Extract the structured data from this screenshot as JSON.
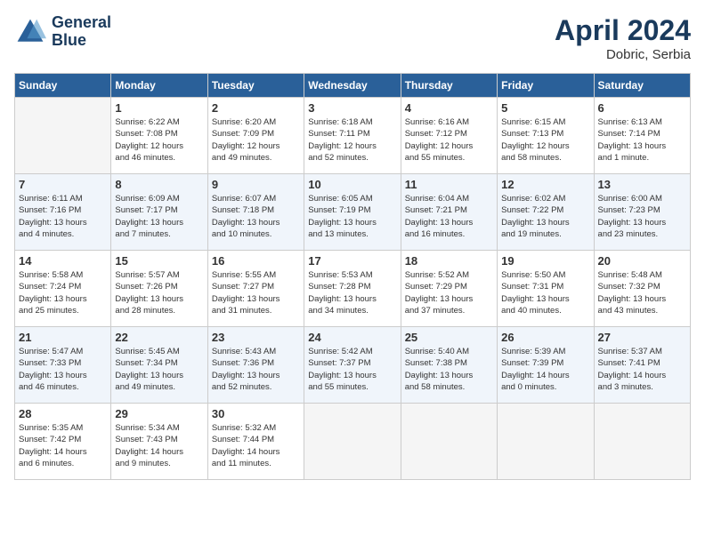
{
  "header": {
    "logo_line1": "General",
    "logo_line2": "Blue",
    "month_title": "April 2024",
    "location": "Dobric, Serbia"
  },
  "weekdays": [
    "Sunday",
    "Monday",
    "Tuesday",
    "Wednesday",
    "Thursday",
    "Friday",
    "Saturday"
  ],
  "weeks": [
    [
      {
        "day": "",
        "info": ""
      },
      {
        "day": "1",
        "info": "Sunrise: 6:22 AM\nSunset: 7:08 PM\nDaylight: 12 hours\nand 46 minutes."
      },
      {
        "day": "2",
        "info": "Sunrise: 6:20 AM\nSunset: 7:09 PM\nDaylight: 12 hours\nand 49 minutes."
      },
      {
        "day": "3",
        "info": "Sunrise: 6:18 AM\nSunset: 7:11 PM\nDaylight: 12 hours\nand 52 minutes."
      },
      {
        "day": "4",
        "info": "Sunrise: 6:16 AM\nSunset: 7:12 PM\nDaylight: 12 hours\nand 55 minutes."
      },
      {
        "day": "5",
        "info": "Sunrise: 6:15 AM\nSunset: 7:13 PM\nDaylight: 12 hours\nand 58 minutes."
      },
      {
        "day": "6",
        "info": "Sunrise: 6:13 AM\nSunset: 7:14 PM\nDaylight: 13 hours\nand 1 minute."
      }
    ],
    [
      {
        "day": "7",
        "info": "Sunrise: 6:11 AM\nSunset: 7:16 PM\nDaylight: 13 hours\nand 4 minutes."
      },
      {
        "day": "8",
        "info": "Sunrise: 6:09 AM\nSunset: 7:17 PM\nDaylight: 13 hours\nand 7 minutes."
      },
      {
        "day": "9",
        "info": "Sunrise: 6:07 AM\nSunset: 7:18 PM\nDaylight: 13 hours\nand 10 minutes."
      },
      {
        "day": "10",
        "info": "Sunrise: 6:05 AM\nSunset: 7:19 PM\nDaylight: 13 hours\nand 13 minutes."
      },
      {
        "day": "11",
        "info": "Sunrise: 6:04 AM\nSunset: 7:21 PM\nDaylight: 13 hours\nand 16 minutes."
      },
      {
        "day": "12",
        "info": "Sunrise: 6:02 AM\nSunset: 7:22 PM\nDaylight: 13 hours\nand 19 minutes."
      },
      {
        "day": "13",
        "info": "Sunrise: 6:00 AM\nSunset: 7:23 PM\nDaylight: 13 hours\nand 23 minutes."
      }
    ],
    [
      {
        "day": "14",
        "info": "Sunrise: 5:58 AM\nSunset: 7:24 PM\nDaylight: 13 hours\nand 25 minutes."
      },
      {
        "day": "15",
        "info": "Sunrise: 5:57 AM\nSunset: 7:26 PM\nDaylight: 13 hours\nand 28 minutes."
      },
      {
        "day": "16",
        "info": "Sunrise: 5:55 AM\nSunset: 7:27 PM\nDaylight: 13 hours\nand 31 minutes."
      },
      {
        "day": "17",
        "info": "Sunrise: 5:53 AM\nSunset: 7:28 PM\nDaylight: 13 hours\nand 34 minutes."
      },
      {
        "day": "18",
        "info": "Sunrise: 5:52 AM\nSunset: 7:29 PM\nDaylight: 13 hours\nand 37 minutes."
      },
      {
        "day": "19",
        "info": "Sunrise: 5:50 AM\nSunset: 7:31 PM\nDaylight: 13 hours\nand 40 minutes."
      },
      {
        "day": "20",
        "info": "Sunrise: 5:48 AM\nSunset: 7:32 PM\nDaylight: 13 hours\nand 43 minutes."
      }
    ],
    [
      {
        "day": "21",
        "info": "Sunrise: 5:47 AM\nSunset: 7:33 PM\nDaylight: 13 hours\nand 46 minutes."
      },
      {
        "day": "22",
        "info": "Sunrise: 5:45 AM\nSunset: 7:34 PM\nDaylight: 13 hours\nand 49 minutes."
      },
      {
        "day": "23",
        "info": "Sunrise: 5:43 AM\nSunset: 7:36 PM\nDaylight: 13 hours\nand 52 minutes."
      },
      {
        "day": "24",
        "info": "Sunrise: 5:42 AM\nSunset: 7:37 PM\nDaylight: 13 hours\nand 55 minutes."
      },
      {
        "day": "25",
        "info": "Sunrise: 5:40 AM\nSunset: 7:38 PM\nDaylight: 13 hours\nand 58 minutes."
      },
      {
        "day": "26",
        "info": "Sunrise: 5:39 AM\nSunset: 7:39 PM\nDaylight: 14 hours\nand 0 minutes."
      },
      {
        "day": "27",
        "info": "Sunrise: 5:37 AM\nSunset: 7:41 PM\nDaylight: 14 hours\nand 3 minutes."
      }
    ],
    [
      {
        "day": "28",
        "info": "Sunrise: 5:35 AM\nSunset: 7:42 PM\nDaylight: 14 hours\nand 6 minutes."
      },
      {
        "day": "29",
        "info": "Sunrise: 5:34 AM\nSunset: 7:43 PM\nDaylight: 14 hours\nand 9 minutes."
      },
      {
        "day": "30",
        "info": "Sunrise: 5:32 AM\nSunset: 7:44 PM\nDaylight: 14 hours\nand 11 minutes."
      },
      {
        "day": "",
        "info": ""
      },
      {
        "day": "",
        "info": ""
      },
      {
        "day": "",
        "info": ""
      },
      {
        "day": "",
        "info": ""
      }
    ]
  ]
}
